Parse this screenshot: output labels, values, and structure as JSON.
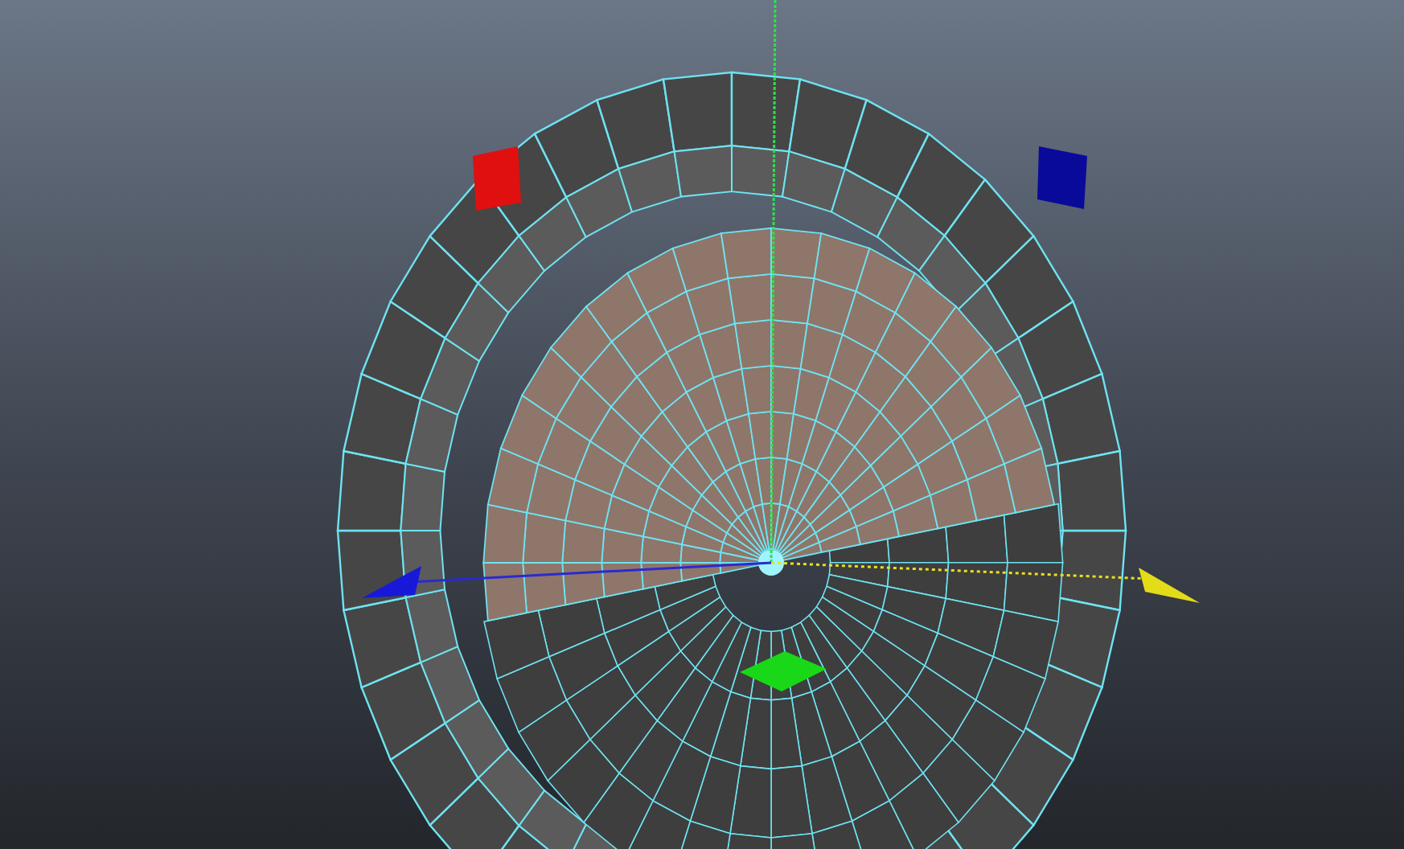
{
  "viewport": {
    "mesh": {
      "selected": true
    }
  }
}
